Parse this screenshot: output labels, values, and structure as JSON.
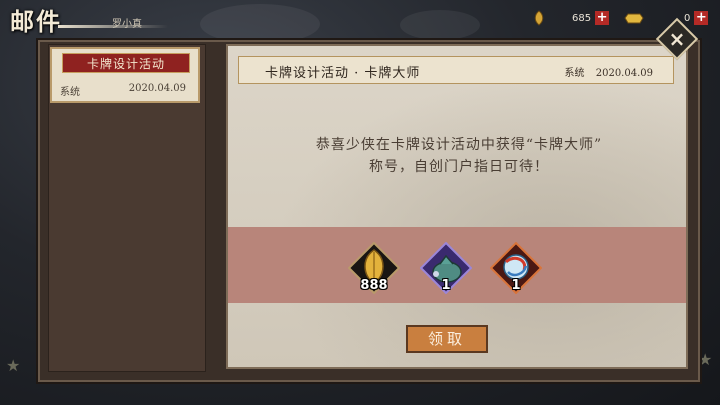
{
  "header": {
    "title": "邮件",
    "subtitle": "罗小真"
  },
  "resources": {
    "leaf_count": "685",
    "ingot_count": "0"
  },
  "mail_list": [
    {
      "title": "卡牌设计活动",
      "sender": "系统",
      "date": "2020.04.09"
    }
  ],
  "mail": {
    "title": "卡牌设计活动 · 卡牌大师",
    "sender": "系统",
    "date": "2020.04.09",
    "body_line1": "恭喜少侠在卡牌设计活动中获得“卡牌大师”",
    "body_line2": "称号，自创门户指日可待！",
    "rewards": [
      {
        "icon": "golden-leaf-icon",
        "count": "888"
      },
      {
        "icon": "cloth-bag-icon",
        "count": "1"
      },
      {
        "icon": "swirl-orb-icon",
        "count": "1"
      }
    ],
    "claim_label": "领取"
  },
  "colors": {
    "accent_red": "#8f2220",
    "claim_orange": "#c97f3f",
    "reward_band": "#b8857a"
  }
}
